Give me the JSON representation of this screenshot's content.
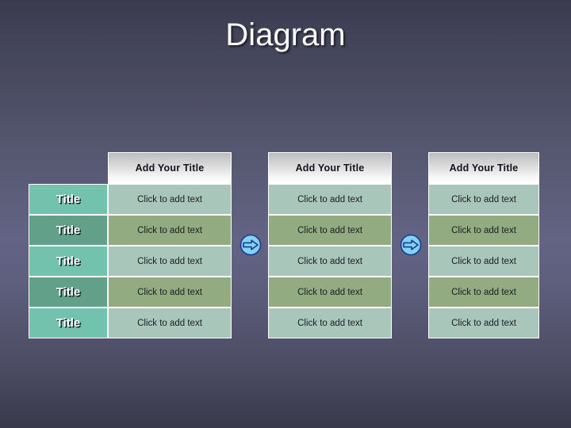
{
  "slide": {
    "title": "Diagram",
    "background_top_color": "#3b3b4f",
    "background_mid_color": "#636484",
    "background_bottom_color": "#3a3a4c"
  },
  "palette": {
    "header_gradient_top": "#bcbcbc",
    "header_gradient_bottom": "#ffffff",
    "title_cell_odd": "#73c2ae",
    "title_cell_even": "#63a089",
    "text_cell_odd": "#a9c6bb",
    "text_cell_even": "#93ab80",
    "cell_border": "#ffffff",
    "arrow_fill": "#7fd4f5",
    "arrow_stroke": "#1f3a8f",
    "title_text": "#ffffff",
    "body_text": "#1d1d24"
  },
  "tables": [
    {
      "name": "table-1",
      "header": "Add Your Title",
      "has_title_column": true,
      "rows": [
        {
          "title": "Title",
          "text": "Click to add text"
        },
        {
          "title": "Title",
          "text": "Click to add text"
        },
        {
          "title": "Title",
          "text": "Click to add text"
        },
        {
          "title": "Title",
          "text": "Click to add text"
        },
        {
          "title": "Title",
          "text": "Click to add text"
        }
      ]
    },
    {
      "name": "table-2",
      "header": "Add Your Title",
      "has_title_column": false,
      "rows": [
        {
          "text": "Click to add text"
        },
        {
          "text": "Click to add text"
        },
        {
          "text": "Click to add text"
        },
        {
          "text": "Click to add text"
        },
        {
          "text": "Click to add text"
        }
      ]
    },
    {
      "name": "table-3",
      "header": "Add Your Title",
      "has_title_column": false,
      "rows": [
        {
          "text": "Click to add text"
        },
        {
          "text": "Click to add text"
        },
        {
          "text": "Click to add text"
        },
        {
          "text": "Click to add text"
        },
        {
          "text": "Click to add text"
        }
      ]
    }
  ],
  "connectors": [
    {
      "name": "arrow-1",
      "icon": "circle-right-arrow-icon"
    },
    {
      "name": "arrow-2",
      "icon": "circle-right-arrow-icon"
    }
  ]
}
